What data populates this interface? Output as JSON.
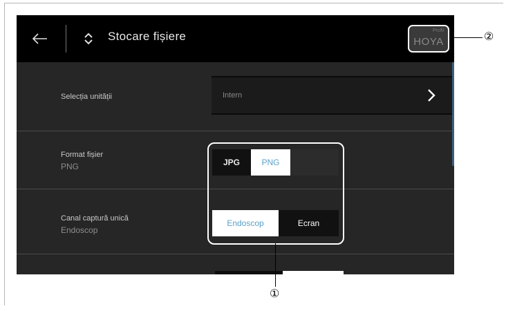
{
  "header": {
    "title": "Stocare fișiere",
    "back_icon": "arrow-left-icon",
    "nav_icon": "diamond-chevron-icon",
    "profile_small_label": "Profil",
    "profile_name": "HOYA"
  },
  "settings": {
    "drive": {
      "label": "Selecția unității",
      "value": "Intern"
    },
    "file_format": {
      "label": "Format fișier",
      "current": "PNG",
      "options": [
        "JPG",
        "PNG"
      ],
      "selected": "PNG"
    },
    "capture_channel": {
      "label": "Canal captură unică",
      "current": "Endoscop",
      "options": [
        "Endoscop",
        "Ecran"
      ],
      "selected": "Endoscop"
    }
  },
  "callouts": {
    "one": "①",
    "two": "②"
  },
  "colors": {
    "screen_bg": "#262626",
    "header_bg": "#000000",
    "selected_text": "#5aa0c8",
    "scrollbar": "#3d5e7a"
  }
}
